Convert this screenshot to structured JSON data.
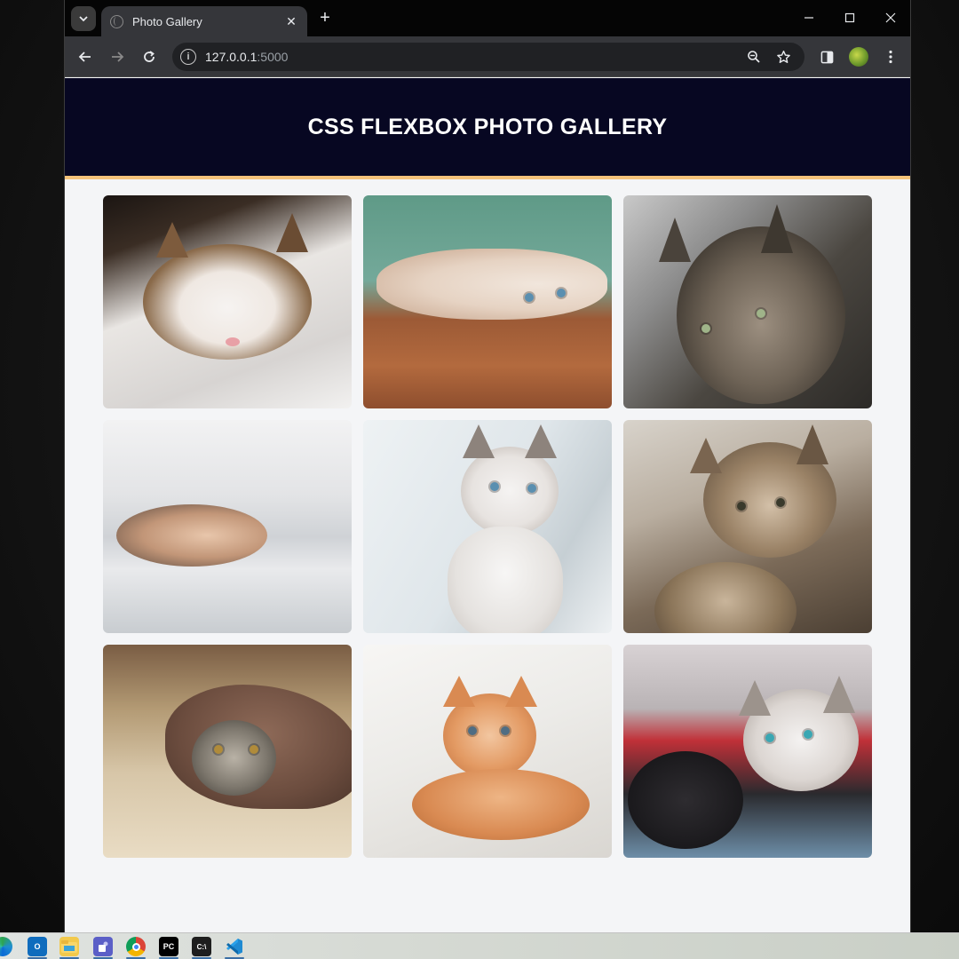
{
  "browser": {
    "tab_title": "Photo Gallery",
    "url_host": "127.0.0.1",
    "url_port": ":5000",
    "info_symbol": "i",
    "tab_close_symbol": "✕",
    "new_tab_symbol": "+",
    "icons": {
      "tab_search": "chevron-down-icon",
      "favicon": "globe-icon",
      "back": "back-arrow-icon",
      "forward": "forward-arrow-icon",
      "reload": "reload-icon",
      "zoom": "zoom-out-icon",
      "bookmark": "star-icon",
      "side_panel": "side-panel-icon",
      "profile": "profile-avatar-icon",
      "menu": "kebab-menu-icon",
      "minimize": "minimize-icon",
      "maximize": "maximize-icon",
      "close": "close-icon"
    }
  },
  "page": {
    "title": "CSS FLEXBOX PHOTO GALLERY",
    "header_bg": "#070722",
    "header_border": "#f4c27a",
    "photos": [
      {
        "subject": "sleeping-tabby-white-cat"
      },
      {
        "subject": "kitten-lying-on-wood-floor"
      },
      {
        "subject": "grey-tabby-cat-portrait"
      },
      {
        "subject": "kitten-under-white-blanket"
      },
      {
        "subject": "white-siamese-kitten"
      },
      {
        "subject": "two-tabby-kittens"
      },
      {
        "subject": "tabby-cat-under-rug"
      },
      {
        "subject": "orange-kitten-lying"
      },
      {
        "subject": "white-and-black-kittens"
      }
    ]
  },
  "taskbar": {
    "apps": [
      "edge",
      "outlook",
      "file-explorer",
      "teams",
      "chrome",
      "pycharm",
      "terminal",
      "vscode"
    ],
    "outlook_label": "O",
    "pycharm_label": "PC",
    "terminal_label": "C:\\"
  }
}
